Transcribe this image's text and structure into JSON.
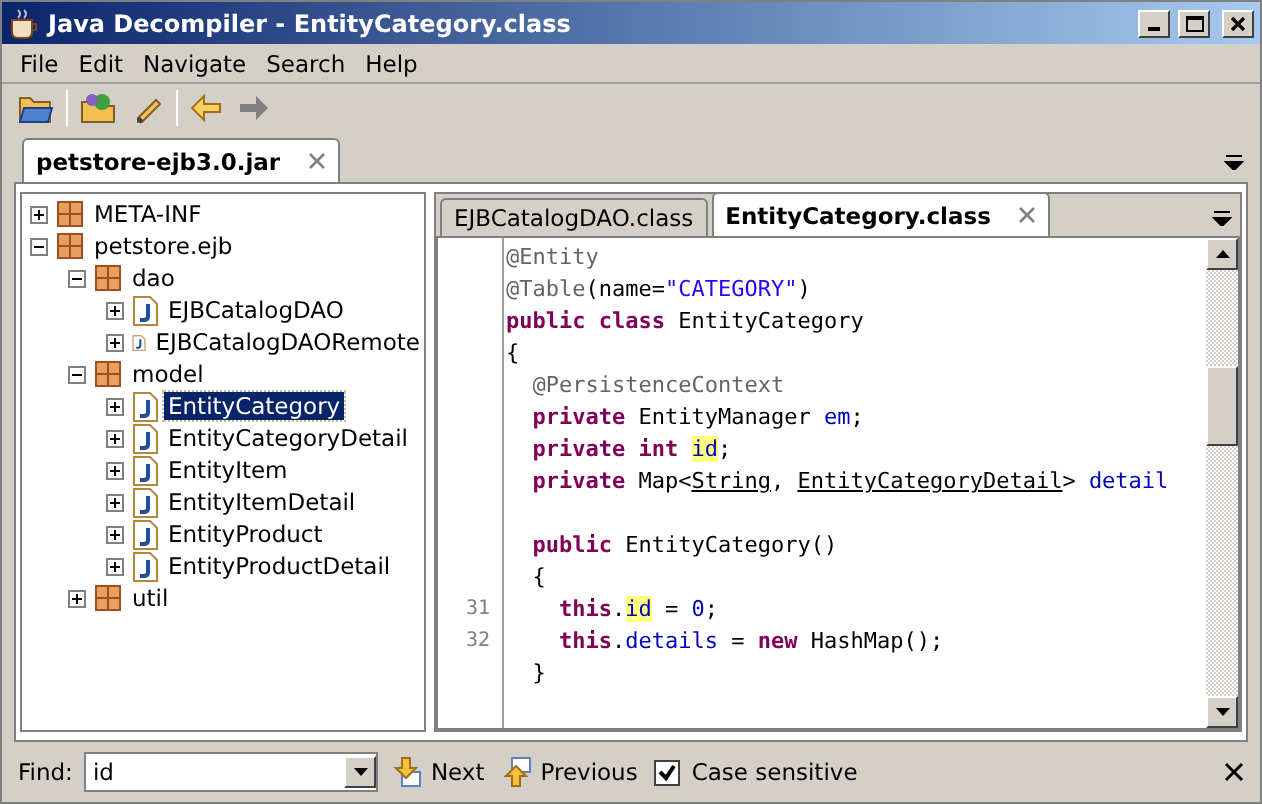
{
  "window": {
    "title": "Java Decompiler - EntityCategory.class"
  },
  "menu": [
    "File",
    "Edit",
    "Navigate",
    "Search",
    "Help"
  ],
  "file_tabs": [
    {
      "label": "petstore-ejb3.0.jar",
      "selected": true
    }
  ],
  "tree": [
    {
      "label": "META-INF",
      "kind": "package",
      "expanded": false,
      "selected": false
    },
    {
      "label": "petstore.ejb",
      "kind": "package",
      "expanded": true,
      "selected": false,
      "children": [
        {
          "label": "dao",
          "kind": "package",
          "expanded": true,
          "selected": false,
          "children": [
            {
              "label": "EJBCatalogDAO",
              "kind": "class",
              "expanded": false,
              "selected": false
            },
            {
              "label": "EJBCatalogDAORemote",
              "kind": "class",
              "expanded": false,
              "selected": false
            }
          ]
        },
        {
          "label": "model",
          "kind": "package",
          "expanded": true,
          "selected": false,
          "children": [
            {
              "label": "EntityCategory",
              "kind": "class",
              "expanded": false,
              "selected": true
            },
            {
              "label": "EntityCategoryDetail",
              "kind": "class",
              "expanded": false,
              "selected": false
            },
            {
              "label": "EntityItem",
              "kind": "class",
              "expanded": false,
              "selected": false
            },
            {
              "label": "EntityItemDetail",
              "kind": "class",
              "expanded": false,
              "selected": false
            },
            {
              "label": "EntityProduct",
              "kind": "class",
              "expanded": false,
              "selected": false
            },
            {
              "label": "EntityProductDetail",
              "kind": "class",
              "expanded": false,
              "selected": false
            }
          ]
        },
        {
          "label": "util",
          "kind": "package",
          "expanded": false,
          "selected": false
        }
      ]
    }
  ],
  "editor_tabs": [
    {
      "label": "EJBCatalogDAO.class",
      "selected": false
    },
    {
      "label": "EntityCategory.class",
      "selected": true
    }
  ],
  "code_lines": [
    {
      "tokens": [
        {
          "text": "@Entity",
          "kind": "ann"
        }
      ]
    },
    {
      "tokens": [
        {
          "text": "@Table",
          "kind": "ann"
        },
        {
          "text": "(name=",
          "kind": "plain"
        },
        {
          "text": "\"CATEGORY\"",
          "kind": "str"
        },
        {
          "text": ")",
          "kind": "plain"
        }
      ]
    },
    {
      "tokens": [
        {
          "text": "public class",
          "kind": "kw"
        },
        {
          "text": " EntityCategory",
          "kind": "plain"
        }
      ]
    },
    {
      "tokens": [
        {
          "text": "{",
          "kind": "plain"
        }
      ]
    },
    {
      "tokens": [
        {
          "text": "  @PersistenceContext",
          "kind": "ann"
        }
      ]
    },
    {
      "tokens": [
        {
          "text": "  private",
          "kind": "kw"
        },
        {
          "text": " EntityManager ",
          "kind": "plain"
        },
        {
          "text": "em",
          "kind": "field"
        },
        {
          "text": ";",
          "kind": "plain"
        }
      ]
    },
    {
      "tokens": [
        {
          "text": "  private int ",
          "kind": "kw"
        },
        {
          "text": "id",
          "kind": "field",
          "highlighted": true
        },
        {
          "text": ";",
          "kind": "plain"
        }
      ]
    },
    {
      "tokens": [
        {
          "text": "  private",
          "kind": "kw"
        },
        {
          "text": " Map<",
          "kind": "plain"
        },
        {
          "text": "String",
          "kind": "type"
        },
        {
          "text": ", ",
          "kind": "plain"
        },
        {
          "text": "EntityCategoryDetail",
          "kind": "type"
        },
        {
          "text": "> ",
          "kind": "plain"
        },
        {
          "text": "detail",
          "kind": "field"
        }
      ]
    },
    {
      "kind": "blank"
    },
    {
      "tokens": [
        {
          "text": "  public",
          "kind": "kw"
        },
        {
          "text": " EntityCategory()",
          "kind": "plain"
        }
      ]
    },
    {
      "tokens": [
        {
          "text": "  {",
          "kind": "plain"
        }
      ]
    },
    {
      "number": "31",
      "tokens": [
        {
          "text": "    this",
          "kind": "kw"
        },
        {
          "text": ".",
          "kind": "plain"
        },
        {
          "text": "id",
          "kind": "field",
          "highlighted": true
        },
        {
          "text": " = ",
          "kind": "plain"
        },
        {
          "text": "0",
          "kind": "field"
        },
        {
          "text": ";",
          "kind": "plain"
        }
      ]
    },
    {
      "number": "32",
      "tokens": [
        {
          "text": "    this",
          "kind": "kw"
        },
        {
          "text": ".",
          "kind": "plain"
        },
        {
          "text": "details",
          "kind": "field"
        },
        {
          "text": " = ",
          "kind": "plain"
        },
        {
          "text": "new",
          "kind": "kw"
        },
        {
          "text": " HashMap();",
          "kind": "plain"
        }
      ]
    },
    {
      "tokens": [
        {
          "text": "  }",
          "kind": "plain"
        }
      ]
    }
  ],
  "find_bar": {
    "label": "Find:",
    "value": "id",
    "next": "Next",
    "previous": "Previous",
    "case_sensitive": {
      "label": "Case sensitive",
      "checked": true
    }
  }
}
